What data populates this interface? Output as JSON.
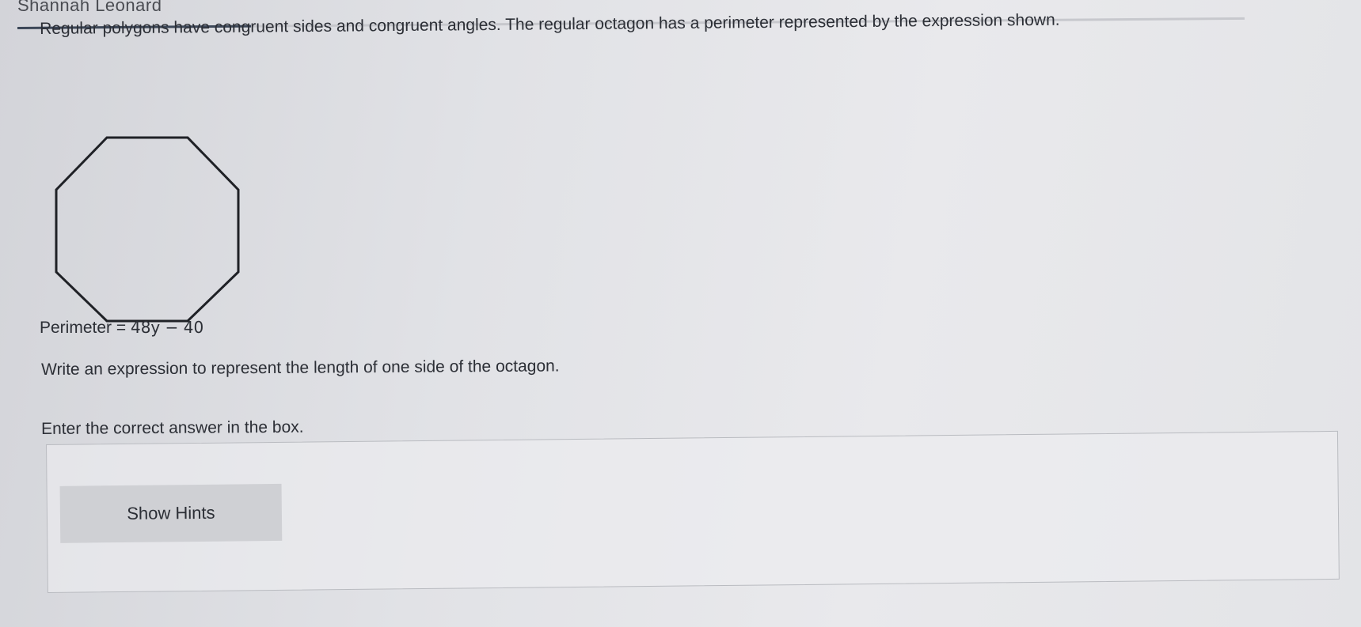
{
  "header": {
    "student_name": "Shannah Leonard",
    "progress_fraction": 0.19
  },
  "question": {
    "prompt_line": "Regular polygons have congruent sides and congruent angles. The regular octagon has a perimeter represented by the expression shown.",
    "figure": {
      "shape": "regular octagon",
      "perimeter_label": "Perimeter",
      "perimeter_equals": "=",
      "perimeter_expression": "48y − 40"
    },
    "task": "Write an expression to represent the length of one side of the octagon.",
    "instruction": "Enter the correct answer in the box."
  },
  "answer_panel": {
    "hints_button_label": "Show Hints"
  },
  "colors": {
    "background": "#e3e4e7",
    "text": "#2c2f36",
    "progress_fill": "#3c4758",
    "button_bg": "#cfd0d4"
  },
  "icons": {
    "octagon": "octagon-figure"
  }
}
